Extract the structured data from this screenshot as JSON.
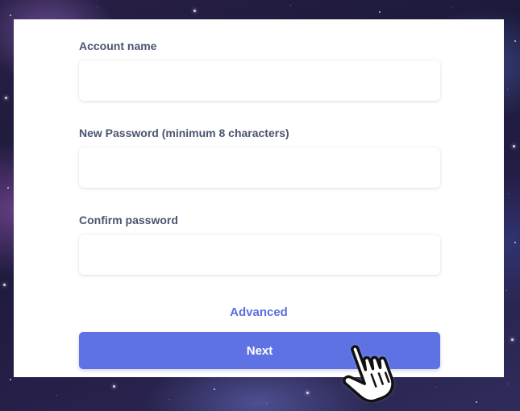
{
  "form": {
    "account_name_label": "Account name",
    "account_name_value": "",
    "new_password_label": "New Password (minimum 8 characters)",
    "new_password_value": "",
    "confirm_password_label": "Confirm password",
    "confirm_password_value": "",
    "advanced_link": "Advanced",
    "next_button": "Next"
  },
  "colors": {
    "accent": "#5f72e3",
    "link": "#5b6fde",
    "label": "#4b5470"
  },
  "icons": {
    "pointer": "hand-pointer-icon"
  }
}
